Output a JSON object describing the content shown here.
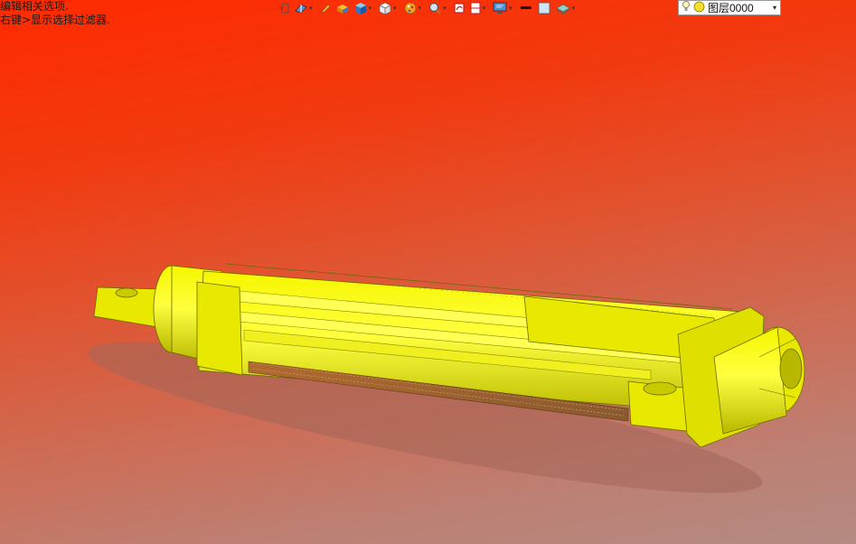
{
  "hints": {
    "line1": "编辑相关选项.",
    "line2": "右键>显示选择过滤器."
  },
  "toolbar": {
    "items": [
      {
        "name": "view-orientation-icon",
        "dropdown": false
      },
      {
        "name": "section-view-icon",
        "dropdown": true
      },
      {
        "name": "sketch-pencil-icon",
        "dropdown": false
      },
      {
        "name": "display-style-icon",
        "dropdown": false
      },
      {
        "name": "view-cube-icon",
        "dropdown": true
      },
      {
        "name": "hide-show-icon",
        "dropdown": true
      },
      {
        "name": "appearance-icon",
        "dropdown": true
      },
      {
        "name": "zoom-icon",
        "dropdown": true
      },
      {
        "name": "rotate-view-icon",
        "dropdown": false
      },
      {
        "name": "split-window-icon",
        "dropdown": true
      },
      {
        "name": "monitor-icon",
        "dropdown": true
      },
      {
        "name": "line-color-icon",
        "dropdown": false
      },
      {
        "name": "fill-color-icon",
        "dropdown": false
      },
      {
        "name": "layers-icon",
        "dropdown": true
      }
    ]
  },
  "layer": {
    "label": "图层0000",
    "icons": [
      "lightbulb-icon",
      "sun-icon"
    ]
  },
  "colors": {
    "model_yellow": "#f0f000",
    "model_dark": "#a0a000",
    "bg_top": "#ff2a00",
    "bg_bottom": "#b48a82"
  }
}
